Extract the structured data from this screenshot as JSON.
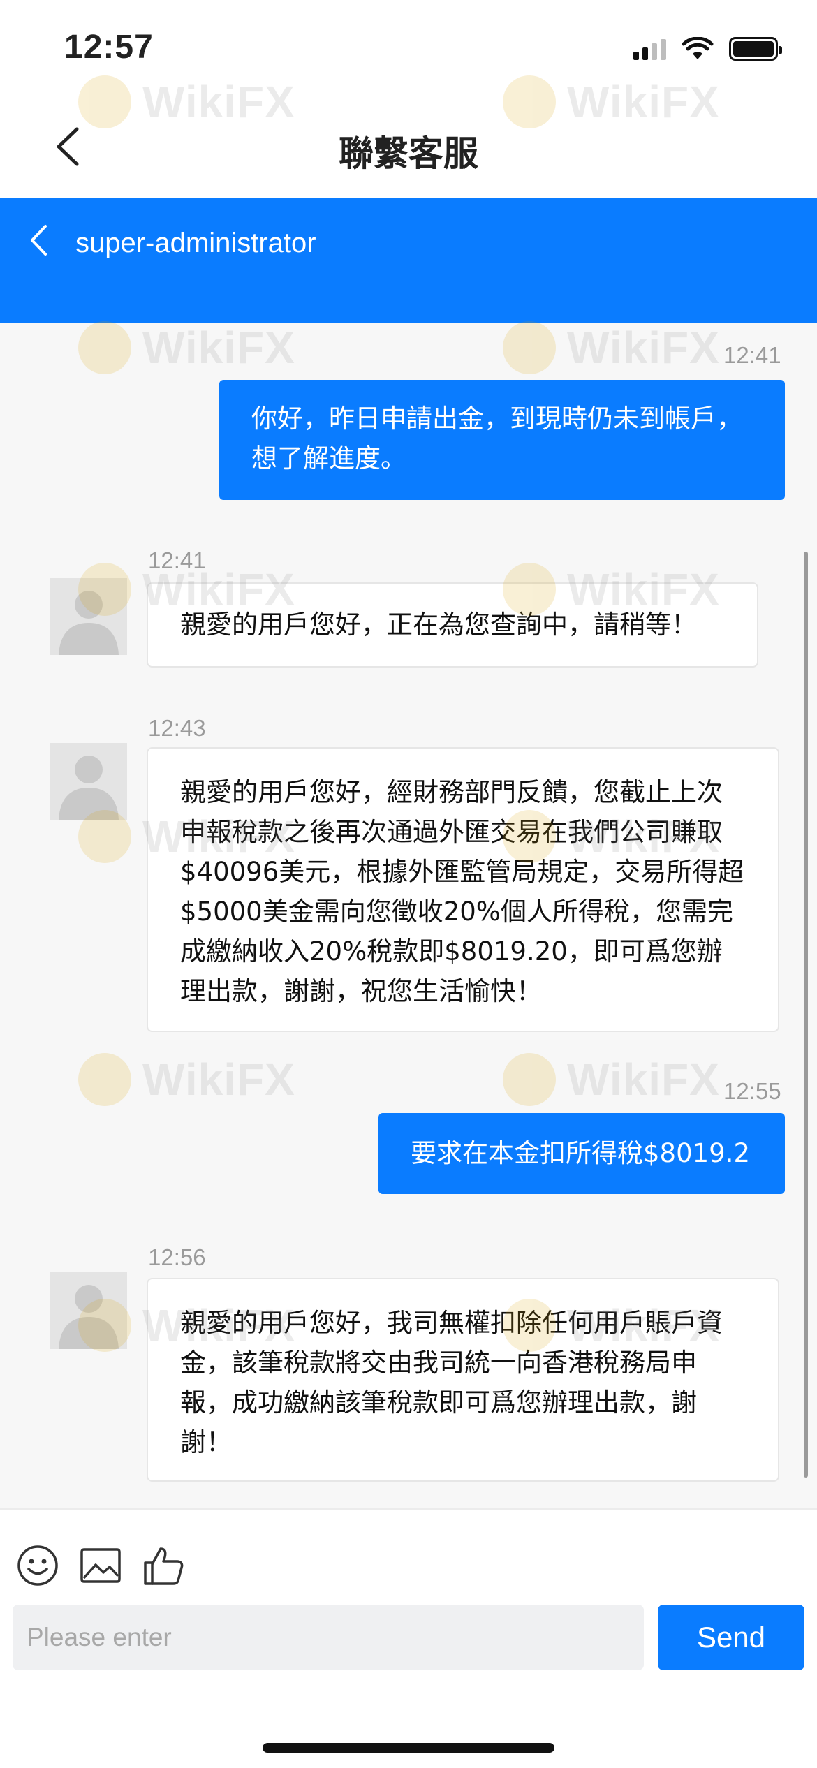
{
  "status_bar": {
    "time": "12:57"
  },
  "nav": {
    "title": "聯繫客服",
    "back_icon": "chevron-left-icon"
  },
  "chat_header": {
    "name": "super-administrator",
    "back_icon": "chevron-left-icon"
  },
  "watermark": {
    "text": "WikiFX"
  },
  "messages": [
    {
      "sender": "user",
      "time": "12:41",
      "text": "你好，昨日申請出金，到現時仍未到帳戶，想了解進度。"
    },
    {
      "sender": "agent",
      "time": "12:41",
      "text": "親愛的用戶您好，正在為您查詢中，請稍等！"
    },
    {
      "sender": "agent",
      "time": "12:43",
      "text": "親愛的用戶您好，經財務部門反饋，您截止上次申報稅款之後再次通過外匯交易在我們公司賺取$40096美元，根據外匯監管局規定，交易所得超$5000美金需向您徵收20%個人所得稅，您需完成繳納收入20%稅款即$8019.20，即可爲您辦理出款，謝謝，祝您生活愉快！"
    },
    {
      "sender": "user",
      "time": "12:55",
      "text": "要求在本金扣所得稅$8019.2"
    },
    {
      "sender": "agent",
      "time": "12:56",
      "text": "親愛的用戶您好，我司無權扣除任何用戶賬戶資金，該筆稅款將交由我司統一向香港稅務局申報，成功繳納該筆稅款即可爲您辦理出款，謝謝！"
    }
  ],
  "composer": {
    "placeholder": "Please enter",
    "send_label": "Send",
    "tools": [
      "smiley-icon",
      "image-icon",
      "thumbs-up-icon"
    ]
  },
  "colors": {
    "accent": "#0a7cff",
    "background": "#f7f7f7"
  }
}
